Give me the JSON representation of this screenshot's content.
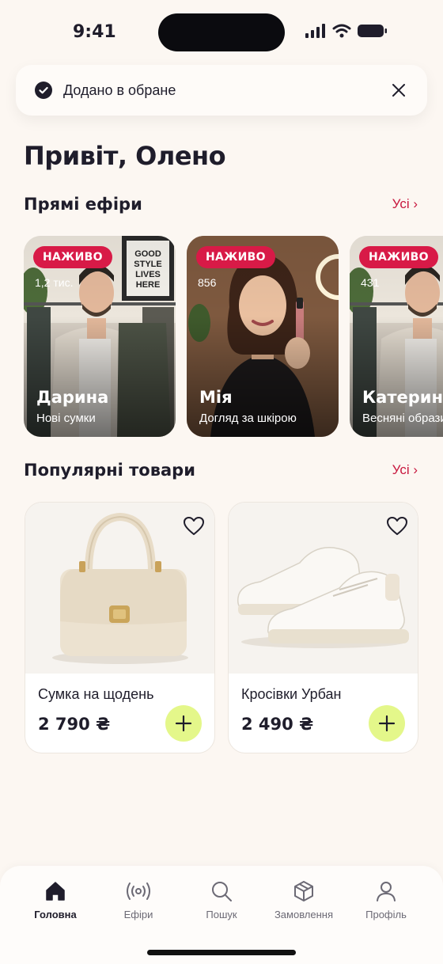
{
  "status": {
    "time": "9:41"
  },
  "toast": {
    "text": "Додано в обране"
  },
  "greeting": "Привіт, Олено",
  "live": {
    "title": "Прямі ефіри",
    "see_all": "Усі ›",
    "badge": "НАЖИВО",
    "cards": [
      {
        "name": "Дарина",
        "topic": "Нові сумки",
        "viewers": "1,2 тис."
      },
      {
        "name": "Мія",
        "topic": "Догляд за шкірою",
        "viewers": "856"
      },
      {
        "name": "Катерина",
        "topic": "Весняні образи",
        "viewers": "431"
      }
    ],
    "poster_text": "GOOD STYLE LIVES HERE"
  },
  "products": {
    "title": "Популярні товари",
    "see_all": "Усі ›",
    "items": [
      {
        "name": "Сумка на щодень",
        "price": "2 790 ₴"
      },
      {
        "name": "Кросівки Урбан",
        "price": "2 490 ₴"
      }
    ]
  },
  "tabs": [
    {
      "label": "Головна",
      "icon": "home-icon",
      "active": true
    },
    {
      "label": "Ефіри",
      "icon": "broadcast-icon",
      "active": false
    },
    {
      "label": "Пошук",
      "icon": "search-icon",
      "active": false
    },
    {
      "label": "Замовлення",
      "icon": "box-icon",
      "active": false
    },
    {
      "label": "Профіль",
      "icon": "user-icon",
      "active": false
    }
  ],
  "colors": {
    "accent": "#d81a47",
    "add_button": "#e4f78a",
    "background": "#fcf7f2"
  }
}
